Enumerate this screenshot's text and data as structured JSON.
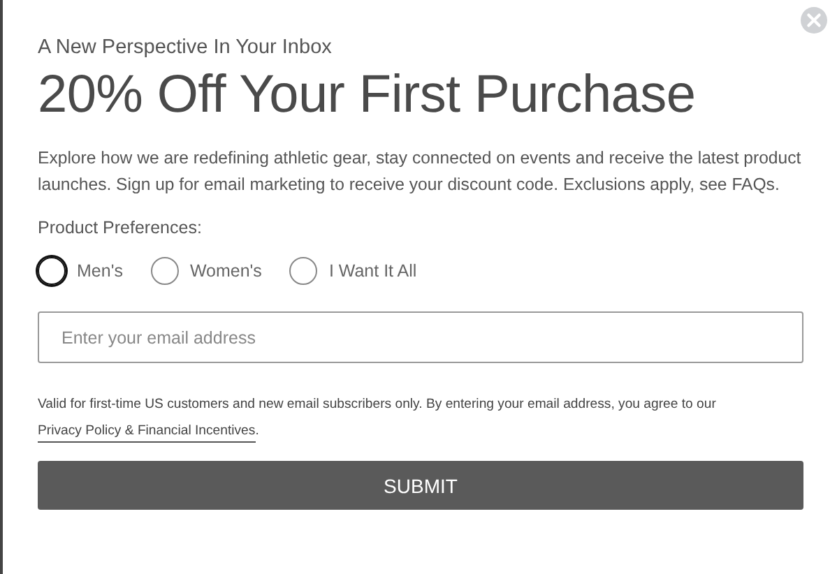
{
  "modal": {
    "subtitle": "A New Perspective In Your Inbox",
    "title": "20% Off Your First Purchase",
    "description": "Explore how we are redefining athletic gear, stay connected on events and receive the latest product launches. Sign up for email marketing to receive your discount code. Exclusions apply, see FAQs.",
    "preferences": {
      "label": "Product Preferences:",
      "options": [
        {
          "label": "Men's",
          "selected": false,
          "focused": true
        },
        {
          "label": "Women's",
          "selected": false,
          "focused": false
        },
        {
          "label": "I Want It All",
          "selected": false,
          "focused": false
        }
      ]
    },
    "email": {
      "placeholder": "Enter your email address"
    },
    "disclaimer": {
      "text": "Valid for first-time US customers and new email subscribers only. By entering your email address, you agree to our",
      "link": "Privacy Policy & Financial Incentives",
      "end": "."
    },
    "submit": "SUBMIT"
  }
}
